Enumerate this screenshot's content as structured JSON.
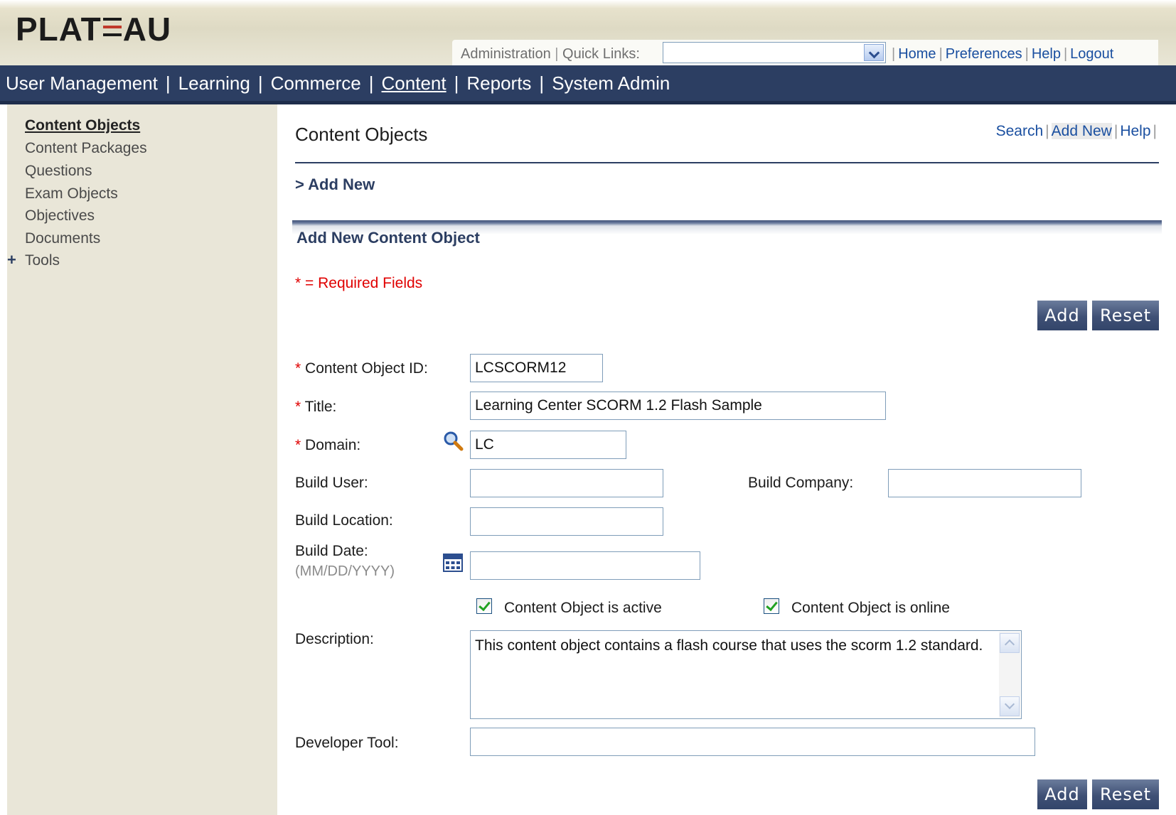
{
  "app": {
    "logo_prefix": "PLAT",
    "logo_suffix": "AU"
  },
  "top_links": {
    "administration": "Administration",
    "quick_links_label": "Quick Links:",
    "quick_links_value": "",
    "home": "Home",
    "preferences": "Preferences",
    "help": "Help",
    "logout": "Logout"
  },
  "main_nav": [
    {
      "label": "User Management",
      "active": false
    },
    {
      "label": "Learning",
      "active": false
    },
    {
      "label": "Commerce",
      "active": false
    },
    {
      "label": "Content",
      "active": true
    },
    {
      "label": "Reports",
      "active": false
    },
    {
      "label": "System Admin",
      "active": false
    }
  ],
  "sidebar": {
    "items": [
      "Content Objects",
      "Content Packages",
      "Questions",
      "Exam Objects",
      "Objectives",
      "Documents",
      "Tools"
    ],
    "expand_symbol": "+"
  },
  "page": {
    "title": "Content Objects",
    "actions": {
      "search": "Search",
      "add_new": "Add New",
      "help": "Help"
    },
    "breadcrumb": "> Add New",
    "section_title": "Add New Content Object",
    "required_note": "* = Required Fields",
    "add_label": "Add",
    "reset_label": "Reset"
  },
  "form": {
    "required_marker": "*",
    "content_object_id": {
      "label": "Content Object ID:",
      "value": "LCSCORM12"
    },
    "title": {
      "label": "Title:",
      "value": "Learning Center SCORM 1.2 Flash Sample"
    },
    "domain": {
      "label": "Domain:",
      "value": "LC"
    },
    "build_user": {
      "label": "Build User:",
      "value": ""
    },
    "build_company": {
      "label": "Build Company:",
      "value": ""
    },
    "build_location": {
      "label": "Build Location:",
      "value": ""
    },
    "build_date": {
      "label": "Build Date:",
      "hint": "(MM/DD/YYYY)",
      "value": ""
    },
    "active": {
      "label": "Content Object is active",
      "checked": true
    },
    "online": {
      "label": "Content Object is online",
      "checked": true
    },
    "description": {
      "label": "Description:",
      "value": "This content object contains a flash course that uses the scorm 1.2 standard."
    },
    "developer_tool": {
      "label": "Developer Tool:",
      "value": ""
    }
  }
}
